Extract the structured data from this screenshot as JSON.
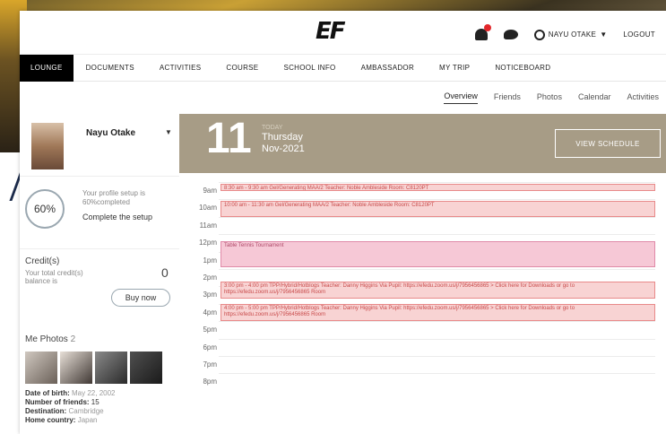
{
  "header": {
    "logo": "EF",
    "user_name": "NAYU OTAKE",
    "logout": "LOGOUT"
  },
  "nav": [
    {
      "label": "LOUNGE",
      "active": true
    },
    {
      "label": "DOCUMENTS"
    },
    {
      "label": "ACTIVITIES"
    },
    {
      "label": "COURSE"
    },
    {
      "label": "SCHOOL INFO"
    },
    {
      "label": "AMBASSADOR"
    },
    {
      "label": "MY TRIP"
    },
    {
      "label": "NOTICEBOARD"
    }
  ],
  "subnav": [
    {
      "label": "Overview",
      "active": true
    },
    {
      "label": "Friends"
    },
    {
      "label": "Photos"
    },
    {
      "label": "Calendar"
    },
    {
      "label": "Activities"
    }
  ],
  "profile": {
    "name": "Nayu Otake",
    "setup_percent": "60%",
    "setup_text": "Your profile setup is 60%completed",
    "setup_link": "Complete the setup"
  },
  "credits": {
    "title": "Credit(s)",
    "desc": "Your total credit(s) balance is",
    "value": "0",
    "buy_label": "Buy now"
  },
  "photos": {
    "title": "Me Photos",
    "count": "2"
  },
  "info": {
    "dob_label": "Date of birth:",
    "dob_value": "May 22, 2002",
    "friends_label": "Number of friends:",
    "friends_value": "15",
    "dest_label": "Destination:",
    "dest_value": "Cambridge",
    "country_label": "Home country:",
    "country_value": "Japan"
  },
  "date": {
    "day": "11",
    "today": "TODAY",
    "weekday": "Thursday",
    "month": "Nov-2021",
    "view_schedule": "VIEW SCHEDULE"
  },
  "schedule": {
    "times": [
      "9am",
      "10am",
      "11am",
      "12pm",
      "1pm",
      "2pm",
      "3pm",
      "4pm",
      "5pm",
      "6pm",
      "7pm",
      "8pm"
    ],
    "events": [
      {
        "text": "8:30 am - 9:30 am    Gel/Generating MAA/2 Teacher: Noble Ambleside Room: C8120PT",
        "top_slot": 0,
        "span": 0.5,
        "pink": false
      },
      {
        "text": "10:00 am - 11:30 am    Gel/Generating MAA/2 Teacher: Noble Ambleside Room: C8120PT",
        "top_slot": 1,
        "span": 1,
        "pink": false
      },
      {
        "text": "Table Tennis Tournament",
        "top_slot": 3.3,
        "span": 1.6,
        "pink": true
      },
      {
        "text": "3:00 pm - 4:00 pm    TPP/Hybrid/Hotblogs Teacher: Danny Higgins Via Pupil: https://efedu.zoom.us/j/7956456865 > Click here for Downloads or go to https://efedu.zoom.us/j/7956456865 Room",
        "top_slot": 5.6,
        "span": 1.1,
        "pink": false
      },
      {
        "text": "4:00 pm - 5:00 pm    TPP/Hybrid/Hotblogs Teacher: Danny Higgins Via Pupil: https://efedu.zoom.us/j/7956456865 > Click here for Downloads or go to https://efedu.zoom.us/j/7956456865 Room",
        "top_slot": 6.9,
        "span": 1.1,
        "pink": false
      }
    ]
  }
}
